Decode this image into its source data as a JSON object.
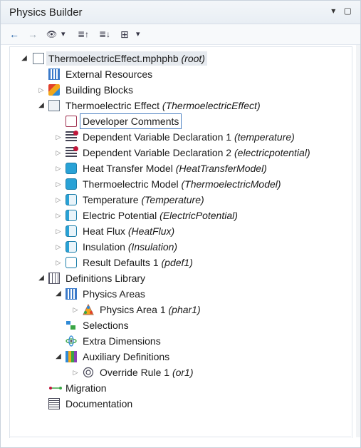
{
  "window": {
    "title": "Physics Builder",
    "controls": "▾ ▢"
  },
  "toolbar": {
    "back": "←",
    "forward": "→",
    "view": "👁",
    "dd1": "▾",
    "sort_up": "≣↑",
    "sort_down": "≣↓",
    "tree_icon": "⊞",
    "dd2": "▾"
  },
  "tree": {
    "root": {
      "name": "ThermoelectricEffect.mphphb",
      "tag": "(root)"
    },
    "external_resources": "External Resources",
    "building_blocks": "Building Blocks",
    "thermo": {
      "name": "Thermoelectric Effect",
      "tag": "(ThermoelectricEffect)"
    },
    "items": [
      {
        "name": "Developer Comments",
        "tag": ""
      },
      {
        "name": "Dependent Variable Declaration 1",
        "tag": "(temperature)"
      },
      {
        "name": "Dependent Variable Declaration 2",
        "tag": "(electricpotential)"
      },
      {
        "name": "Heat Transfer Model",
        "tag": "(HeatTransferModel)"
      },
      {
        "name": "Thermoelectric Model",
        "tag": "(ThermoelectricModel)"
      },
      {
        "name": "Temperature",
        "tag": "(Temperature)"
      },
      {
        "name": "Electric Potential",
        "tag": "(ElectricPotential)"
      },
      {
        "name": "Heat Flux",
        "tag": "(HeatFlux)"
      },
      {
        "name": "Insulation",
        "tag": "(Insulation)"
      },
      {
        "name": "Result Defaults 1",
        "tag": "(pdef1)"
      }
    ],
    "definitions_library": "Definitions Library",
    "physics_areas": "Physics Areas",
    "physics_area_1": {
      "name": "Physics Area 1",
      "tag": "(phar1)"
    },
    "selections": "Selections",
    "extra_dimensions": "Extra Dimensions",
    "auxiliary_definitions": "Auxiliary Definitions",
    "override_rule_1": {
      "name": "Override Rule 1",
      "tag": "(or1)"
    },
    "migration": "Migration",
    "documentation": "Documentation"
  }
}
